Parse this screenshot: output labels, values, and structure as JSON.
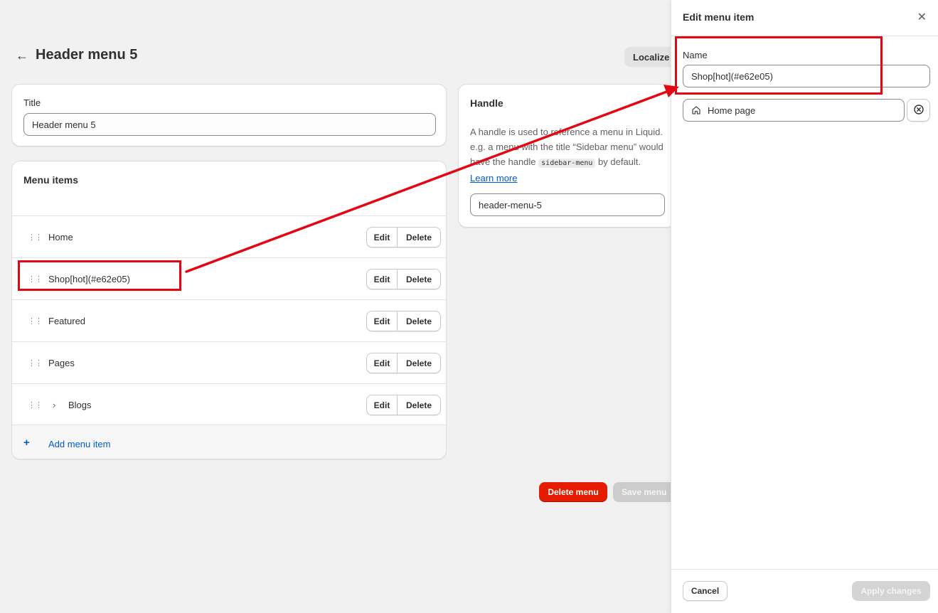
{
  "page": {
    "title": "Header menu 5",
    "localize_label": "Localize"
  },
  "title_card": {
    "label": "Title",
    "value": "Header menu 5"
  },
  "menu_card": {
    "title": "Menu items",
    "items": [
      {
        "label": "Home"
      },
      {
        "label": "Shop[hot](#e62e05)"
      },
      {
        "label": "Featured"
      },
      {
        "label": "Pages"
      },
      {
        "label": "Blogs"
      }
    ],
    "edit_label": "Edit",
    "delete_label": "Delete",
    "add_label": "Add menu item"
  },
  "handle_card": {
    "title": "Handle",
    "desc_1": "A handle is used to reference a menu in Liquid. e.g. a menu with the title “Sidebar menu” would have the handle",
    "desc_code": "sidebar-menu",
    "desc_2": "by default.",
    "learn_more": "Learn more",
    "value": "header-menu-5"
  },
  "actions": {
    "delete_menu": "Delete menu",
    "save_menu": "Save menu"
  },
  "panel": {
    "title": "Edit menu item",
    "name_label": "Name",
    "name_value": "Shop[hot](#e62e05)",
    "link_value": "Home page",
    "cancel": "Cancel",
    "apply": "Apply changes"
  },
  "colors": {
    "highlight": "#e30613",
    "danger": "#e51c00",
    "link": "#005bd3"
  }
}
